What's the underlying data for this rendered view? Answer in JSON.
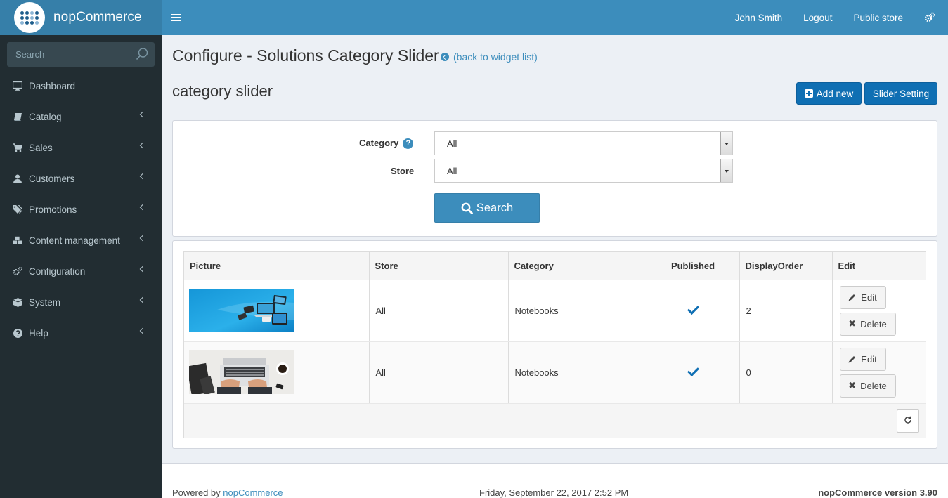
{
  "app": {
    "logo_text": "nopCommerce"
  },
  "topbar": {
    "user_name": "John Smith",
    "logout": "Logout",
    "public_store": "Public store"
  },
  "sidebar": {
    "search_placeholder": "Search",
    "items": [
      {
        "label": "Dashboard",
        "icon": "desktop-icon",
        "has_children": false
      },
      {
        "label": "Catalog",
        "icon": "book-icon",
        "has_children": true
      },
      {
        "label": "Sales",
        "icon": "cart-icon",
        "has_children": true
      },
      {
        "label": "Customers",
        "icon": "user-icon",
        "has_children": true
      },
      {
        "label": "Promotions",
        "icon": "tags-icon",
        "has_children": true
      },
      {
        "label": "Content management",
        "icon": "cubes-icon",
        "has_children": true
      },
      {
        "label": "Configuration",
        "icon": "gears-icon",
        "has_children": true
      },
      {
        "label": "System",
        "icon": "cube-icon",
        "has_children": true
      },
      {
        "label": "Help",
        "icon": "question-circle-icon",
        "has_children": true
      }
    ]
  },
  "page": {
    "title": "Configure - Solutions Category Slider",
    "back_link": "(back to widget list)",
    "subtitle": "category slider",
    "add_new": "Add new",
    "slider_setting": "Slider Setting"
  },
  "search_form": {
    "category_label": "Category",
    "category_value": "All",
    "store_label": "Store",
    "store_value": "All",
    "search_button": "Search"
  },
  "grid": {
    "columns": [
      "Picture",
      "Store",
      "Category",
      "Published",
      "DisplayOrder",
      "Edit"
    ],
    "rows": [
      {
        "picture": "devices-banner",
        "store": "All",
        "category": "Notebooks",
        "published": true,
        "display_order": "2",
        "edit": "Edit",
        "delete": "Delete"
      },
      {
        "picture": "laptop-desk-photo",
        "store": "All",
        "category": "Notebooks",
        "published": true,
        "display_order": "0",
        "edit": "Edit",
        "delete": "Delete"
      }
    ]
  },
  "footer": {
    "powered_by": "Powered by ",
    "powered_link": "nopCommerce",
    "datetime": "Friday, September 22, 2017 2:52 PM",
    "version": "nopCommerce version 3.90"
  },
  "colors": {
    "brand": "#3c8dbc",
    "brand_dark": "#367fa9",
    "sidebar_bg": "#222d32",
    "primary_button": "#0f6fb3"
  }
}
